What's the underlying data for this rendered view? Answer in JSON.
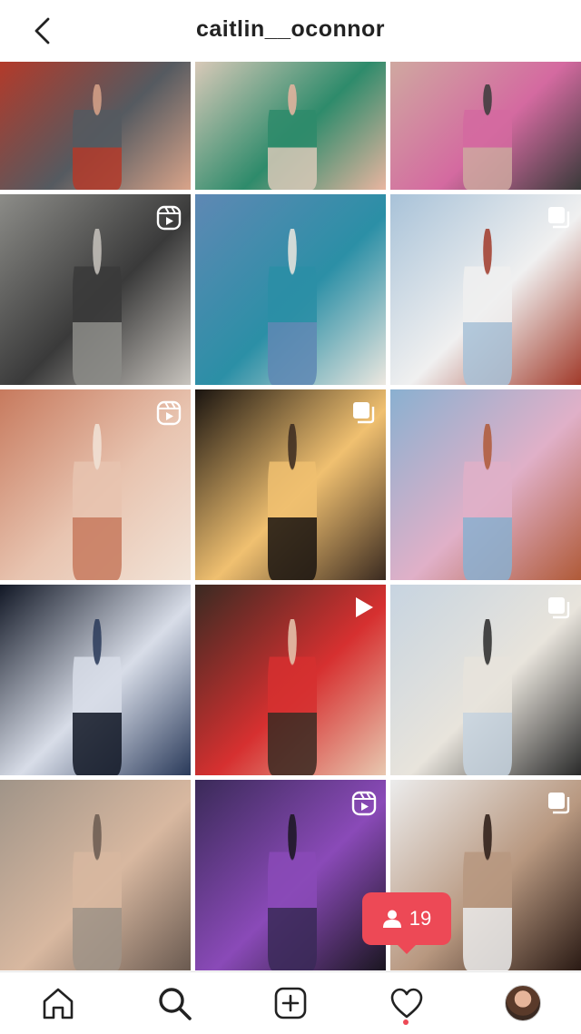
{
  "header": {
    "username": "caitlin__oconnor",
    "back_icon": "chevron-left-icon"
  },
  "grid": {
    "columns": 3,
    "tiles": [
      {
        "name": "post-1",
        "badge": "none",
        "colors": [
          "#b33a2a",
          "#555a60",
          "#d9a48a"
        ]
      },
      {
        "name": "post-2",
        "badge": "none",
        "colors": [
          "#d8c9b8",
          "#2e8b6b",
          "#e9b5a0"
        ]
      },
      {
        "name": "post-3",
        "badge": "none",
        "colors": [
          "#cfa8a0",
          "#d46aa0",
          "#3a3a3a"
        ]
      },
      {
        "name": "post-4",
        "badge": "reel",
        "colors": [
          "#8c8c88",
          "#3a3a3a",
          "#c8c4be"
        ]
      },
      {
        "name": "post-5",
        "badge": "none",
        "colors": [
          "#5f88b4",
          "#2b8fa6",
          "#ede8e0"
        ]
      },
      {
        "name": "post-6",
        "badge": "carousel",
        "colors": [
          "#a8c2d8",
          "#f0f0f0",
          "#a13a2a"
        ]
      },
      {
        "name": "post-7",
        "badge": "reel",
        "colors": [
          "#c77a5e",
          "#e8c4b0",
          "#f2e4d8"
        ]
      },
      {
        "name": "post-8",
        "badge": "carousel",
        "colors": [
          "#1a1410",
          "#f0c070",
          "#3a2a20"
        ]
      },
      {
        "name": "post-9",
        "badge": "none",
        "colors": [
          "#8ab0d0",
          "#e0b0c8",
          "#b05a38"
        ]
      },
      {
        "name": "post-10",
        "badge": "none",
        "colors": [
          "#121826",
          "#d8dde8",
          "#2a3a5a"
        ]
      },
      {
        "name": "post-11",
        "badge": "video",
        "colors": [
          "#3a2a22",
          "#d63030",
          "#e8c8b0"
        ]
      },
      {
        "name": "post-12",
        "badge": "carousel",
        "colors": [
          "#c7d4e0",
          "#e8e4dc",
          "#2a2a2a"
        ]
      },
      {
        "name": "post-13",
        "badge": "none",
        "colors": [
          "#a09488",
          "#d8b8a0",
          "#6a5a50"
        ]
      },
      {
        "name": "post-14",
        "badge": "reel",
        "colors": [
          "#3a2a58",
          "#8a4ab8",
          "#1a1620"
        ]
      },
      {
        "name": "post-15",
        "badge": "carousel",
        "colors": [
          "#ececec",
          "#b89880",
          "#2a1a14"
        ]
      }
    ]
  },
  "notification": {
    "count": "19",
    "icon": "person-icon"
  },
  "nav": {
    "items": [
      {
        "name": "home",
        "icon": "home-icon"
      },
      {
        "name": "search",
        "icon": "search-icon"
      },
      {
        "name": "create",
        "icon": "plus-square-icon"
      },
      {
        "name": "activity",
        "icon": "heart-icon"
      },
      {
        "name": "profile",
        "icon": "avatar"
      }
    ]
  },
  "colors": {
    "accent": "#ed4956",
    "text": "#222222"
  }
}
